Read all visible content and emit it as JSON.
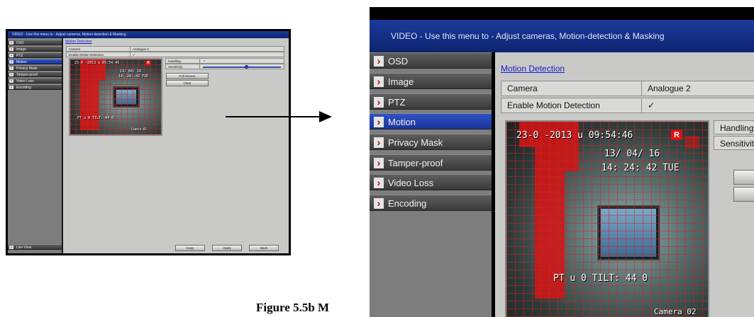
{
  "screen": {
    "title": "VIDEO - Use this menu to - Adjust cameras, Motion-detection & Masking",
    "menu": [
      {
        "label": "OSD",
        "active": false
      },
      {
        "label": "Image",
        "active": false
      },
      {
        "label": "PTZ",
        "active": false
      },
      {
        "label": "Motion",
        "active": true
      },
      {
        "label": "Privacy Mask",
        "active": false
      },
      {
        "label": "Tamper-proof",
        "active": false
      },
      {
        "label": "Video Loss",
        "active": false
      },
      {
        "label": "Encoding",
        "active": false
      }
    ],
    "live_view_label": "Live View",
    "section_title": "Motion Detection",
    "camera_label": "Camera",
    "camera_value": "Analogue 2",
    "enable_label": "Enable Motion Detection",
    "enable_checked": "✓",
    "handling_label": "Handling",
    "sensitivity_label": "Sensitivity",
    "sensitivity_level": 0.55,
    "full_screen_label": "Full Screen",
    "clear_label": "Clear",
    "copy_label": "Copy",
    "apply_label": "Apply",
    "back_label": "Back",
    "preview": {
      "date_text": "23-0 -2013",
      "time_text": "u 09:54:46",
      "rec_badge": "R",
      "osd_date": "13/ 04/ 16",
      "osd_time": "14: 24: 42  TUE",
      "ptz_text": "PT u 0",
      "tilt_text": "TILT: 44 0",
      "camera_name": "Camera 02"
    }
  },
  "large_view": {
    "title": "VIDEO - Use this menu to - Adjust cameras, Motion-detection & Masking",
    "handling_label": "Handling",
    "sensitivity_label": "Sensitivit",
    "full_label": "Fu"
  },
  "caption": "Figure 5.5b   M"
}
